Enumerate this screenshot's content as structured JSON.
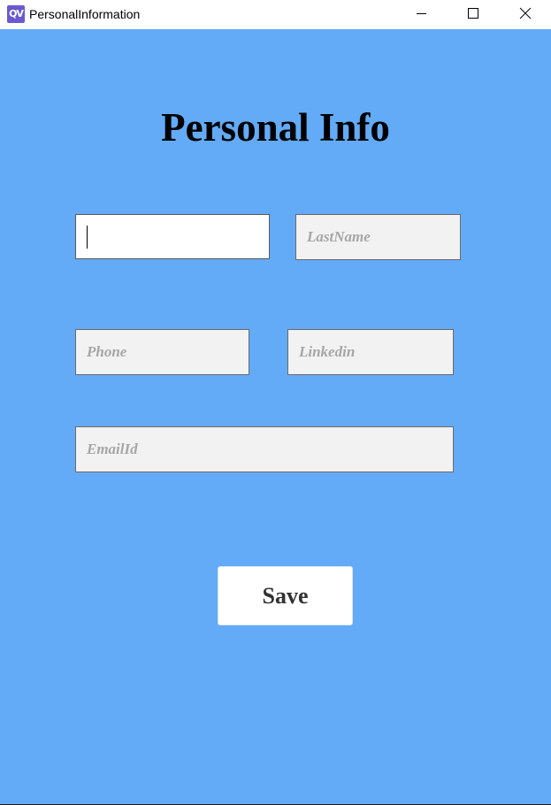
{
  "window": {
    "title": "PersonalInformation",
    "icon": "qt-logo-icon",
    "controls": [
      "minimize-icon",
      "maximize-icon",
      "close-icon"
    ]
  },
  "form": {
    "heading": "Personal Info",
    "fields": {
      "first_name": {
        "value": "",
        "placeholder": ""
      },
      "last_name": {
        "value": "",
        "placeholder": "LastName"
      },
      "phone": {
        "value": "",
        "placeholder": "Phone"
      },
      "linkedin": {
        "value": "",
        "placeholder": "Linkedin"
      },
      "email": {
        "value": "",
        "placeholder": "EmailId"
      }
    },
    "save_label": "Save"
  },
  "colors": {
    "background": "#63aaf7",
    "field_background": "#f2f2f2",
    "placeholder_text": "#a6a6a6",
    "button_background": "#ffffff"
  }
}
